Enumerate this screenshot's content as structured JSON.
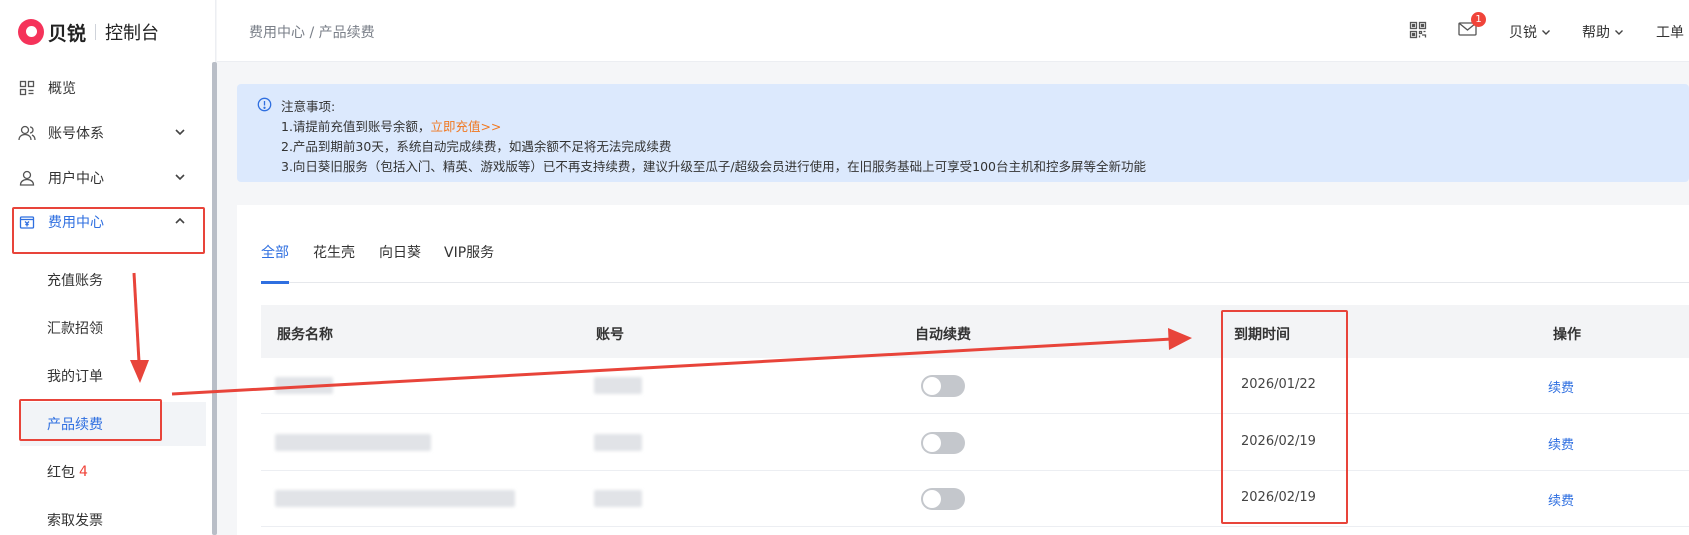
{
  "brand": {
    "name": "贝锐",
    "console": "控制台"
  },
  "sidebar": {
    "items": [
      {
        "label": "概览"
      },
      {
        "label": "账号体系"
      },
      {
        "label": "用户中心"
      },
      {
        "label": "费用中心"
      }
    ],
    "sub_items": [
      {
        "label": "充值账务"
      },
      {
        "label": "汇款招领"
      },
      {
        "label": "我的订单"
      },
      {
        "label": "产品续费"
      },
      {
        "label": "红包",
        "count": "4"
      },
      {
        "label": "索取发票"
      }
    ]
  },
  "header": {
    "breadcrumb": "费用中心 / 产品续费",
    "mail_badge": "1",
    "user_menu": "贝锐",
    "help_menu": "帮助",
    "ticket_menu": "工单"
  },
  "notice": {
    "title": "注意事项:",
    "line1": "1.请提前充值到账号余额，",
    "line1_link": "立即充值>>",
    "line2": "2.产品到期前30天，系统自动完成续费，如遇余额不足将无法完成续费",
    "line3": "3.向日葵旧服务（包括入门、精英、游戏版等）已不再支持续费，建议升级至瓜子/超级会员进行使用，在旧服务基础上可享受100台主机和控多屏等全新功能"
  },
  "tabs": [
    {
      "label": "全部"
    },
    {
      "label": "花生壳"
    },
    {
      "label": "向日葵"
    },
    {
      "label": "VIP服务"
    }
  ],
  "table": {
    "headers": [
      "服务名称",
      "账号",
      "自动续费",
      "到期时间",
      "操作"
    ],
    "rows": [
      {
        "expiry": "2026/01/22",
        "action": "续费",
        "auto_renew": false
      },
      {
        "expiry": "2026/02/19",
        "action": "续费",
        "auto_renew": false
      },
      {
        "expiry": "2026/02/19",
        "action": "续费",
        "auto_renew": false
      }
    ]
  },
  "colors": {
    "accent": "#2f6fe0",
    "annotation": "#e8443a",
    "brand": "#f5335a",
    "notice_bg": "#dce9fd"
  }
}
